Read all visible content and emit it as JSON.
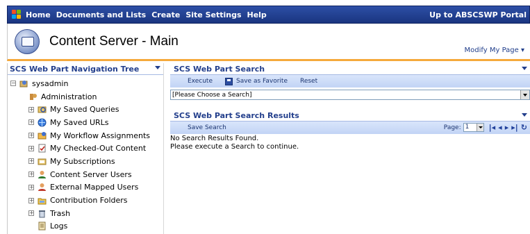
{
  "topnav": {
    "items": [
      "Home",
      "Documents and Lists",
      "Create",
      "Site Settings",
      "Help"
    ],
    "portal_link": "Up to ABSCSWP Portal"
  },
  "header": {
    "title": "Content Server - Main",
    "modify_link": "Modify My Page ▾"
  },
  "nav_tree": {
    "title": "SCS Web Part Navigation Tree",
    "root": "sysadmin",
    "items": [
      {
        "label": "Administration",
        "icon": "admin-icon",
        "expandable": false
      },
      {
        "label": "My Saved Queries",
        "icon": "saved-queries-icon",
        "expandable": true
      },
      {
        "label": "My Saved URLs",
        "icon": "saved-urls-icon",
        "expandable": true
      },
      {
        "label": "My Workflow Assignments",
        "icon": "workflow-icon",
        "expandable": true
      },
      {
        "label": "My Checked-Out Content",
        "icon": "checked-out-icon",
        "expandable": true
      },
      {
        "label": "My Subscriptions",
        "icon": "subscriptions-icon",
        "expandable": true
      },
      {
        "label": "Content Server Users",
        "icon": "users-icon",
        "expandable": true
      },
      {
        "label": "External Mapped Users",
        "icon": "external-users-icon",
        "expandable": true
      },
      {
        "label": "Contribution Folders",
        "icon": "folders-icon",
        "expandable": true
      },
      {
        "label": "Trash",
        "icon": "trash-icon",
        "expandable": true
      },
      {
        "label": "Logs",
        "icon": "logs-icon",
        "expandable": false
      }
    ]
  },
  "search": {
    "title": "SCS Web Part Search",
    "execute": "Execute",
    "save_favorite": "Save as Favorite",
    "reset": "Reset",
    "select_value": "[Please Choose a Search]"
  },
  "results": {
    "title": "SCS Web Part Search Results",
    "save_search": "Save Search",
    "page_label": "Page:",
    "page_value": "1",
    "message1": "No Search Results Found.",
    "message2": "Please execute a Search to continue."
  },
  "colors": {
    "nav_bar": "#1a3580",
    "accent_orange": "#f5a93b",
    "header_text": "#233f8c"
  }
}
